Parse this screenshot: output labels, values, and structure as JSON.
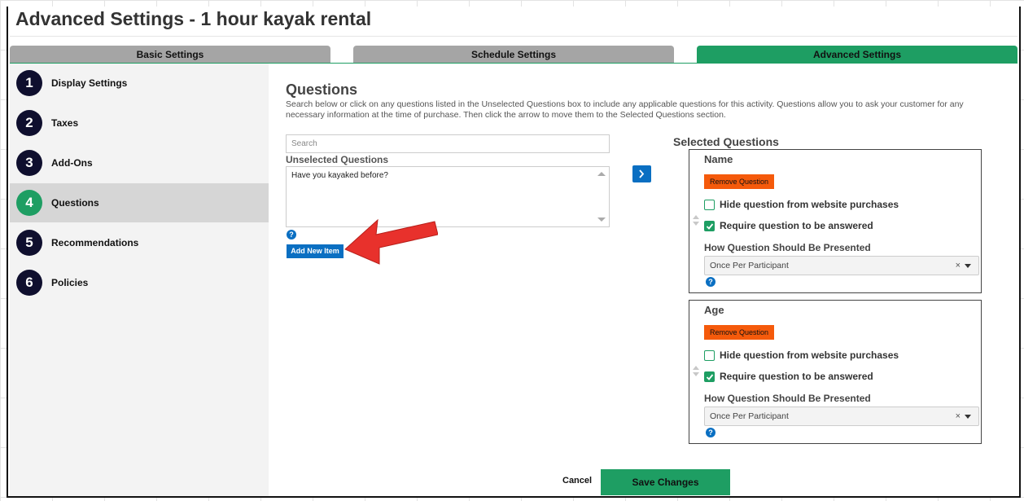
{
  "page_title": "Advanced Settings - 1 hour kayak rental",
  "tabs": [
    {
      "label": "Basic Settings",
      "active": false
    },
    {
      "label": "Schedule Settings",
      "active": false
    },
    {
      "label": "Advanced Settings",
      "active": true
    }
  ],
  "sidebar": {
    "items": [
      {
        "num": "1",
        "label": "Display Settings"
      },
      {
        "num": "2",
        "label": "Taxes"
      },
      {
        "num": "3",
        "label": "Add-Ons"
      },
      {
        "num": "4",
        "label": "Questions",
        "active": true
      },
      {
        "num": "5",
        "label": "Recommendations"
      },
      {
        "num": "6",
        "label": "Policies"
      }
    ]
  },
  "questions": {
    "title": "Questions",
    "description": "Search below or click on any questions listed in the Unselected Questions box to include any applicable questions for this activity. Questions allow you to ask your customer for any necessary information at the time of purchase. Then click the arrow to move them to the Selected Questions section.",
    "search_placeholder": "Search",
    "unselected_label": "Unselected Questions",
    "unselected_items": [
      "Have you kayaked before?"
    ],
    "help_glyph": "?",
    "add_new_label": "Add New Item"
  },
  "selected": {
    "title": "Selected Questions",
    "cards": [
      {
        "name": "Name",
        "remove_label": "Remove Question",
        "hide_label": "Hide question from website purchases",
        "hide_checked": false,
        "require_label": "Require question to be answered",
        "require_checked": true,
        "presented_label": "How Question Should Be Presented",
        "presented_value": "Once Per Participant",
        "clear_glyph": "×",
        "help_glyph": "?"
      },
      {
        "name": "Age",
        "remove_label": "Remove Question",
        "hide_label": "Hide question from website purchases",
        "hide_checked": false,
        "require_label": "Require question to be answered",
        "require_checked": true,
        "presented_label": "How Question Should Be Presented",
        "presented_value": "Once Per Participant",
        "clear_glyph": "×",
        "help_glyph": "?"
      }
    ]
  },
  "footer": {
    "cancel_label": "Cancel",
    "save_label": "Save Changes"
  },
  "colors": {
    "accent_green": "#1e9e63",
    "tab_inactive": "#a5a5a5",
    "nav_circle": "#0f0f2e",
    "primary_blue": "#0a6fc2",
    "remove_orange": "#f55a0b",
    "annotation_arrow": "#e8312c"
  },
  "icons": {
    "move_right": "chevron-right-icon",
    "annotation": "red-arrow-annotation",
    "drag": "drag-handle-icon",
    "check": "check-icon",
    "help": "help-icon"
  }
}
